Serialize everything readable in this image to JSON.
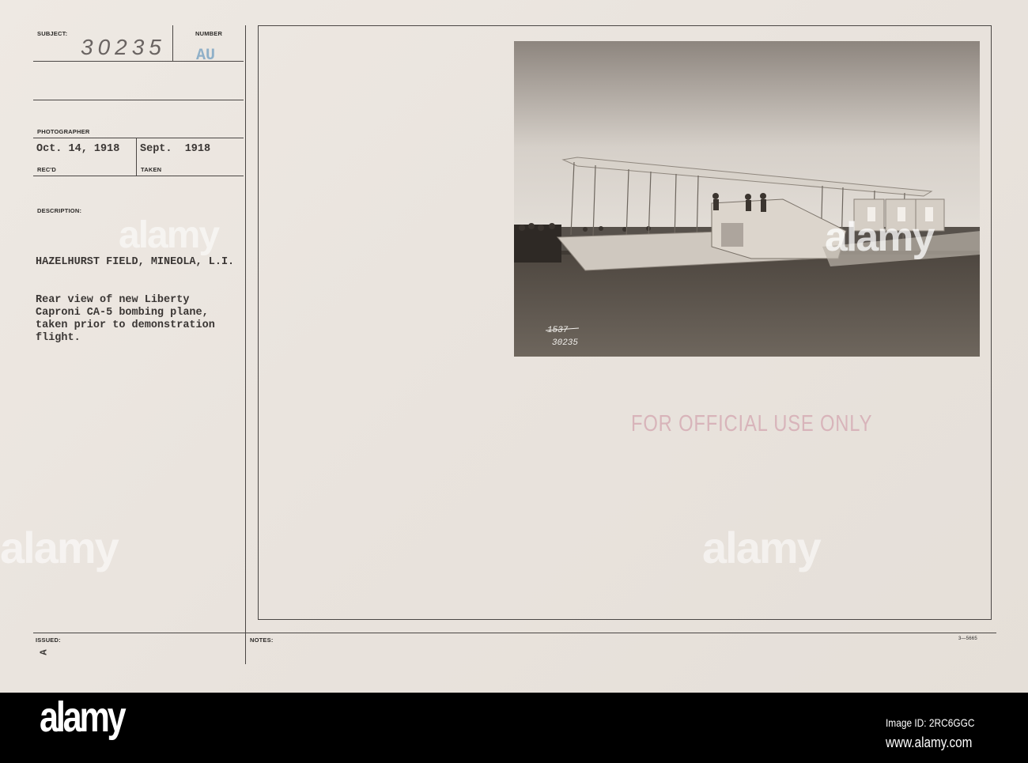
{
  "card": {
    "subject_label": "SUBJECT:",
    "number_label": "NUMBER",
    "subject_number": "30235",
    "number_stamp": "AU",
    "photographer_label": "PHOTOGRAPHER",
    "recd_date": "Oct. 14, 1918",
    "taken_date": "Sept.  1918",
    "recd_label": "REC'D",
    "taken_label": "TAKEN",
    "description_label": "DESCRIPTION:",
    "location": "HAZELHURST FIELD, MINEOLA, L.I.",
    "description_lines": [
      "Rear view of new Liberty",
      "Caproni CA-5 bombing plane,",
      "taken prior to demonstration",
      "flight."
    ],
    "issued_label": "ISSUED:",
    "issued_mark": "A",
    "notes_label": "NOTES:",
    "form_number": "3—5665",
    "stamp": "FOR OFFICIAL USE ONLY",
    "photo_numbers": [
      "1537",
      "30235"
    ]
  },
  "colors": {
    "card": "#ebe6e0",
    "ink": "#3a3634",
    "stamp": "#d8b4ba",
    "number_stamp": "#8fb0c8"
  },
  "watermark": {
    "text": "alamy",
    "image_id": "Image ID: 2RC6GGC",
    "url": "www.alamy.com"
  }
}
